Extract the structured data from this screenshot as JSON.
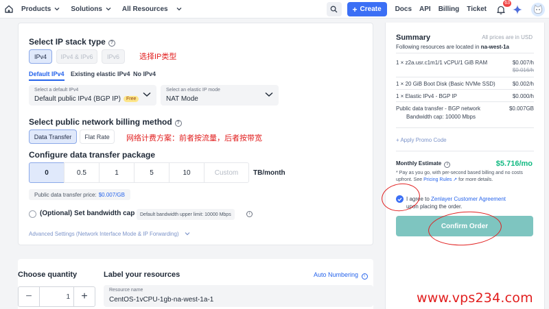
{
  "nav": {
    "menu": [
      "Products",
      "Solutions",
      "All Resources"
    ],
    "create_label": "Create",
    "links": [
      "Docs",
      "API",
      "Billing",
      "Ticket"
    ],
    "notification_count": "63"
  },
  "ip_stack": {
    "title": "Select IP stack type",
    "options": [
      "IPv4",
      "IPv4 & IPv6",
      "IPv6"
    ],
    "selected": "IPv4",
    "annotation": "选择IP类型"
  },
  "ip_tabs": [
    "Default IPv4",
    "Existing elastic IPv4",
    "No IPv4"
  ],
  "default_ipv4": {
    "label": "Select a default IPv4",
    "value": "Default public IPv4 (BGP IP)",
    "badge": "Free"
  },
  "elastic_mode": {
    "label": "Select an elastic IP mode",
    "value": "NAT Mode"
  },
  "billing": {
    "title": "Select public network billing method",
    "options": [
      "Data Transfer",
      "Flat Rate"
    ],
    "annotation": "网络计费方案：前者按流量，后者按带宽"
  },
  "transfer": {
    "title": "Configure data transfer package",
    "options": [
      "0",
      "0.5",
      "1",
      "5",
      "10"
    ],
    "custom_placeholder": "Custom",
    "unit": "TB/month",
    "price_label": "Public data transfer price:",
    "price_value": "$0.007/GB"
  },
  "bandwidth": {
    "title": "(Optional) Set bandwidth cap",
    "hint": "Default bandwidth upper limit: 10000 Mbps"
  },
  "advanced": "Advanced Settings (Network Interface Mode & IP Forwarding)",
  "quantity": {
    "title": "Choose quantity",
    "value": "1"
  },
  "labels": {
    "title": "Label your resources",
    "auto_numbering": "Auto Numbering",
    "field_label": "Resource name",
    "field_value": "CentOS-1vCPU-1gb-na-west-1a-1"
  },
  "summary": {
    "title": "Summary",
    "note": "All prices are in USD",
    "location_text": "Following resources are located in",
    "location": "na-west-1a",
    "lines": [
      {
        "name": "1 × z2a.usr.c1m1/1 vCPU/1 GiB RAM",
        "price": "$0.007/h",
        "old": "$0.016/h"
      },
      {
        "name": "1 × 20 GiB Boot Disk (Basic NVMe SSD)",
        "price": "$0.002/h"
      },
      {
        "name": "1 × Elastic IPv4 - BGP IP",
        "price": "$0.000/h"
      },
      {
        "name": "Public data transfer - BGP network",
        "name2": "Bandwidth cap: 10000 Mbps",
        "price": "$0.007GB"
      }
    ],
    "promo": "+ Apply Promo Code",
    "estimate_label": "Monthly Estimate",
    "estimate_value": "$5.716/mo",
    "fine_print": "* Pay as you go, with per-second based billing and no costs upfront. See",
    "fine_link": "Pricing Rules",
    "fine_tail": "for more details.",
    "agree_text": "I agree to",
    "agree_link": "Zenlayer Customer Agreement",
    "agree_tail": "upon placing the order.",
    "confirm_label": "Confirm Order"
  },
  "watermark": "www.vps234.com"
}
